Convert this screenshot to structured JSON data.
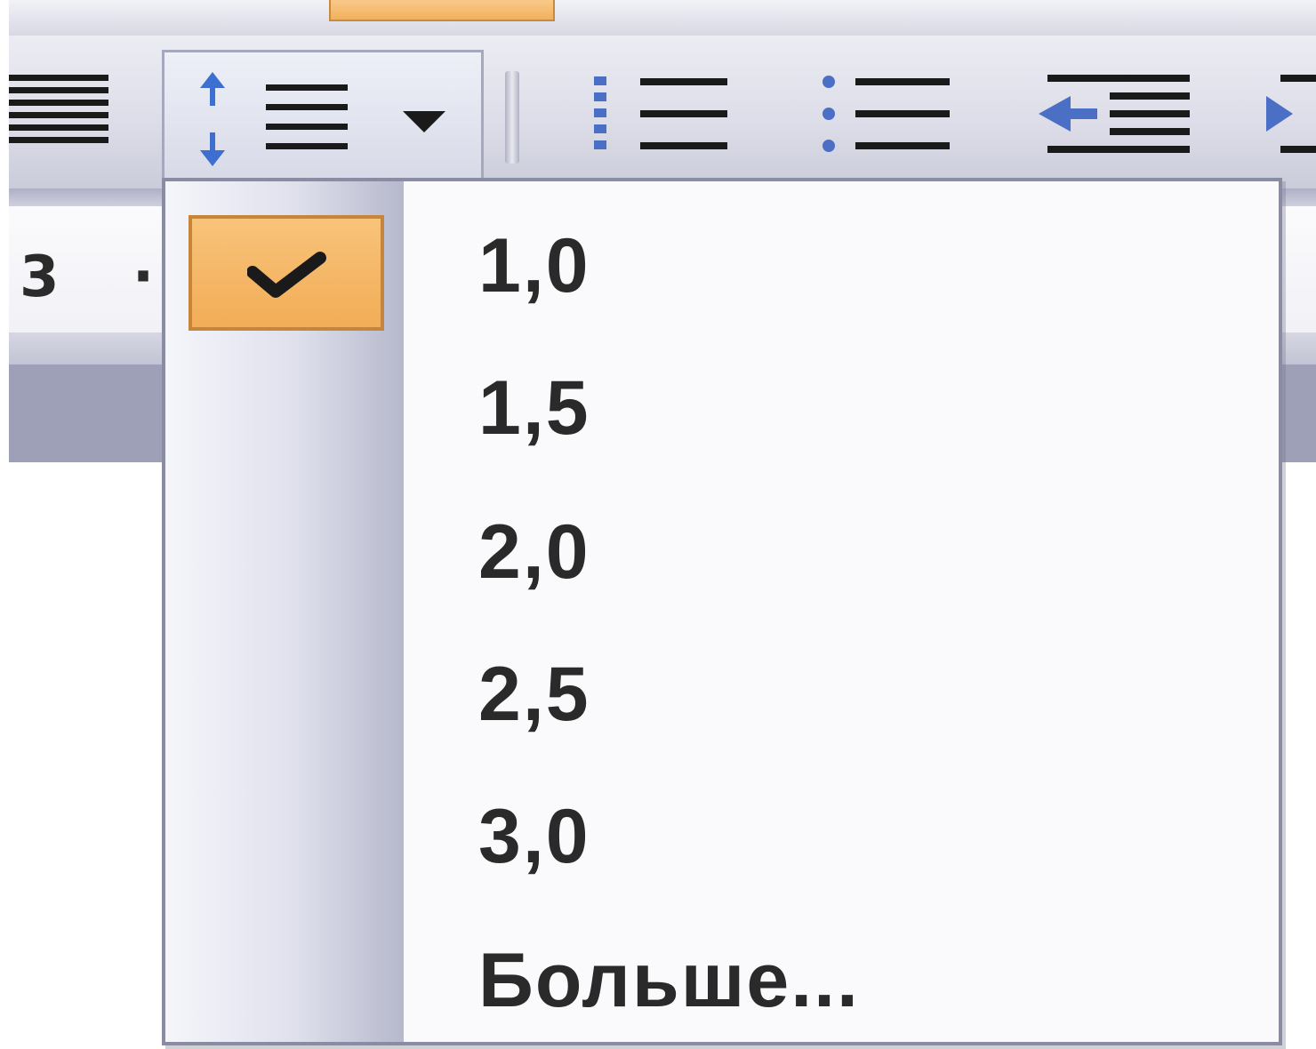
{
  "toolbar": {
    "buttons": [
      {
        "icon": "justify-align-icon"
      },
      {
        "icon": "line-spacing-icon",
        "has_dropdown": true
      },
      {
        "icon": "numbered-list-icon"
      },
      {
        "icon": "bulleted-list-icon"
      },
      {
        "icon": "decrease-indent-icon"
      },
      {
        "icon": "increase-indent-icon"
      }
    ]
  },
  "ruler": {
    "text": "3 ·"
  },
  "line_spacing_menu": {
    "items": [
      {
        "label": "1,0",
        "checked": true
      },
      {
        "label": "1,5",
        "checked": false
      },
      {
        "label": "2,0",
        "checked": false
      },
      {
        "label": "2,5",
        "checked": false
      },
      {
        "label": "3,0",
        "checked": false
      },
      {
        "label": "Больше...",
        "checked": false
      }
    ]
  },
  "colors": {
    "highlight": "#f2ad57",
    "menu_border": "#8a8ca3",
    "toolbar_bg": "#dcdde8"
  }
}
